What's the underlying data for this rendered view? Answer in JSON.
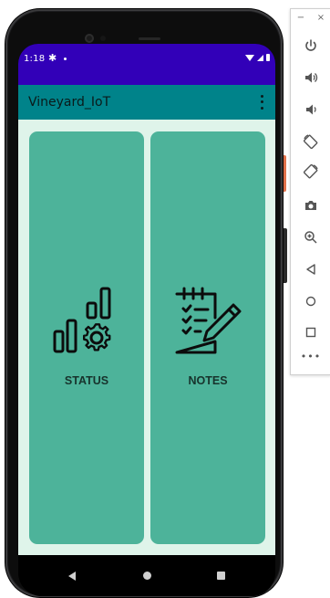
{
  "status_bar": {
    "time": "1:18",
    "gear_glyph": "✱"
  },
  "app_bar": {
    "title": "Vineyard_IoT"
  },
  "cards": {
    "status": {
      "label": "STATUS",
      "icon": "chart-gear-icon"
    },
    "notes": {
      "label": "NOTES",
      "icon": "notepad-pencil-icon"
    }
  },
  "emulator": {
    "minimize": "−",
    "close": "×",
    "more": "•••"
  },
  "colors": {
    "status_bar": "#3200b8",
    "app_bar": "#00838a",
    "content_bg": "#dff4ea",
    "card": "#4db39a"
  }
}
